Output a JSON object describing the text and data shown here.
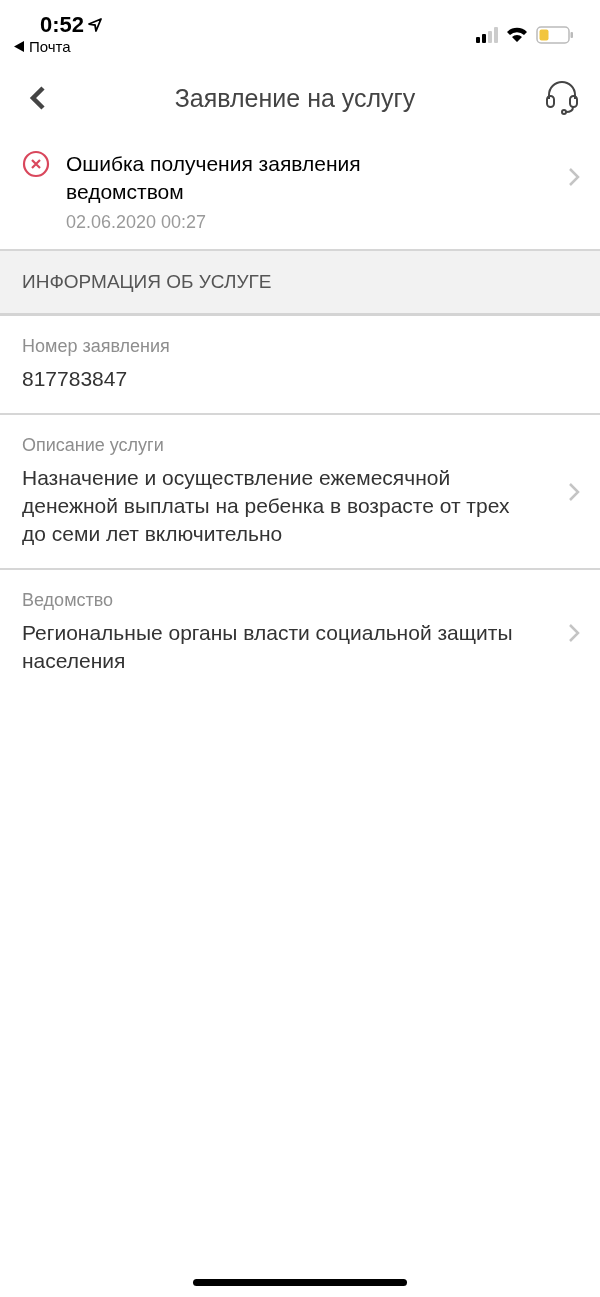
{
  "status_bar": {
    "time": "0:52",
    "back_app": "Почта"
  },
  "nav": {
    "title": "Заявление на услугу"
  },
  "status": {
    "kind": "error",
    "title": "Ошибка получения заявления ведомством",
    "date": "02.06.2020 00:27"
  },
  "section": {
    "title": "ИНФОРМАЦИЯ ОБ УСЛУГЕ"
  },
  "fields": [
    {
      "kind": "plain",
      "label": "Номер заявления",
      "value": "817783847"
    },
    {
      "kind": "link",
      "label": "Описание услуги",
      "value": "Назначение и осуществление ежемесячной денежной выплаты на ребенка в возрасте от трех до семи лет включительно"
    },
    {
      "kind": "link",
      "label": "Ведомство",
      "value": "Региональные органы власти социальной защиты населения"
    }
  ]
}
